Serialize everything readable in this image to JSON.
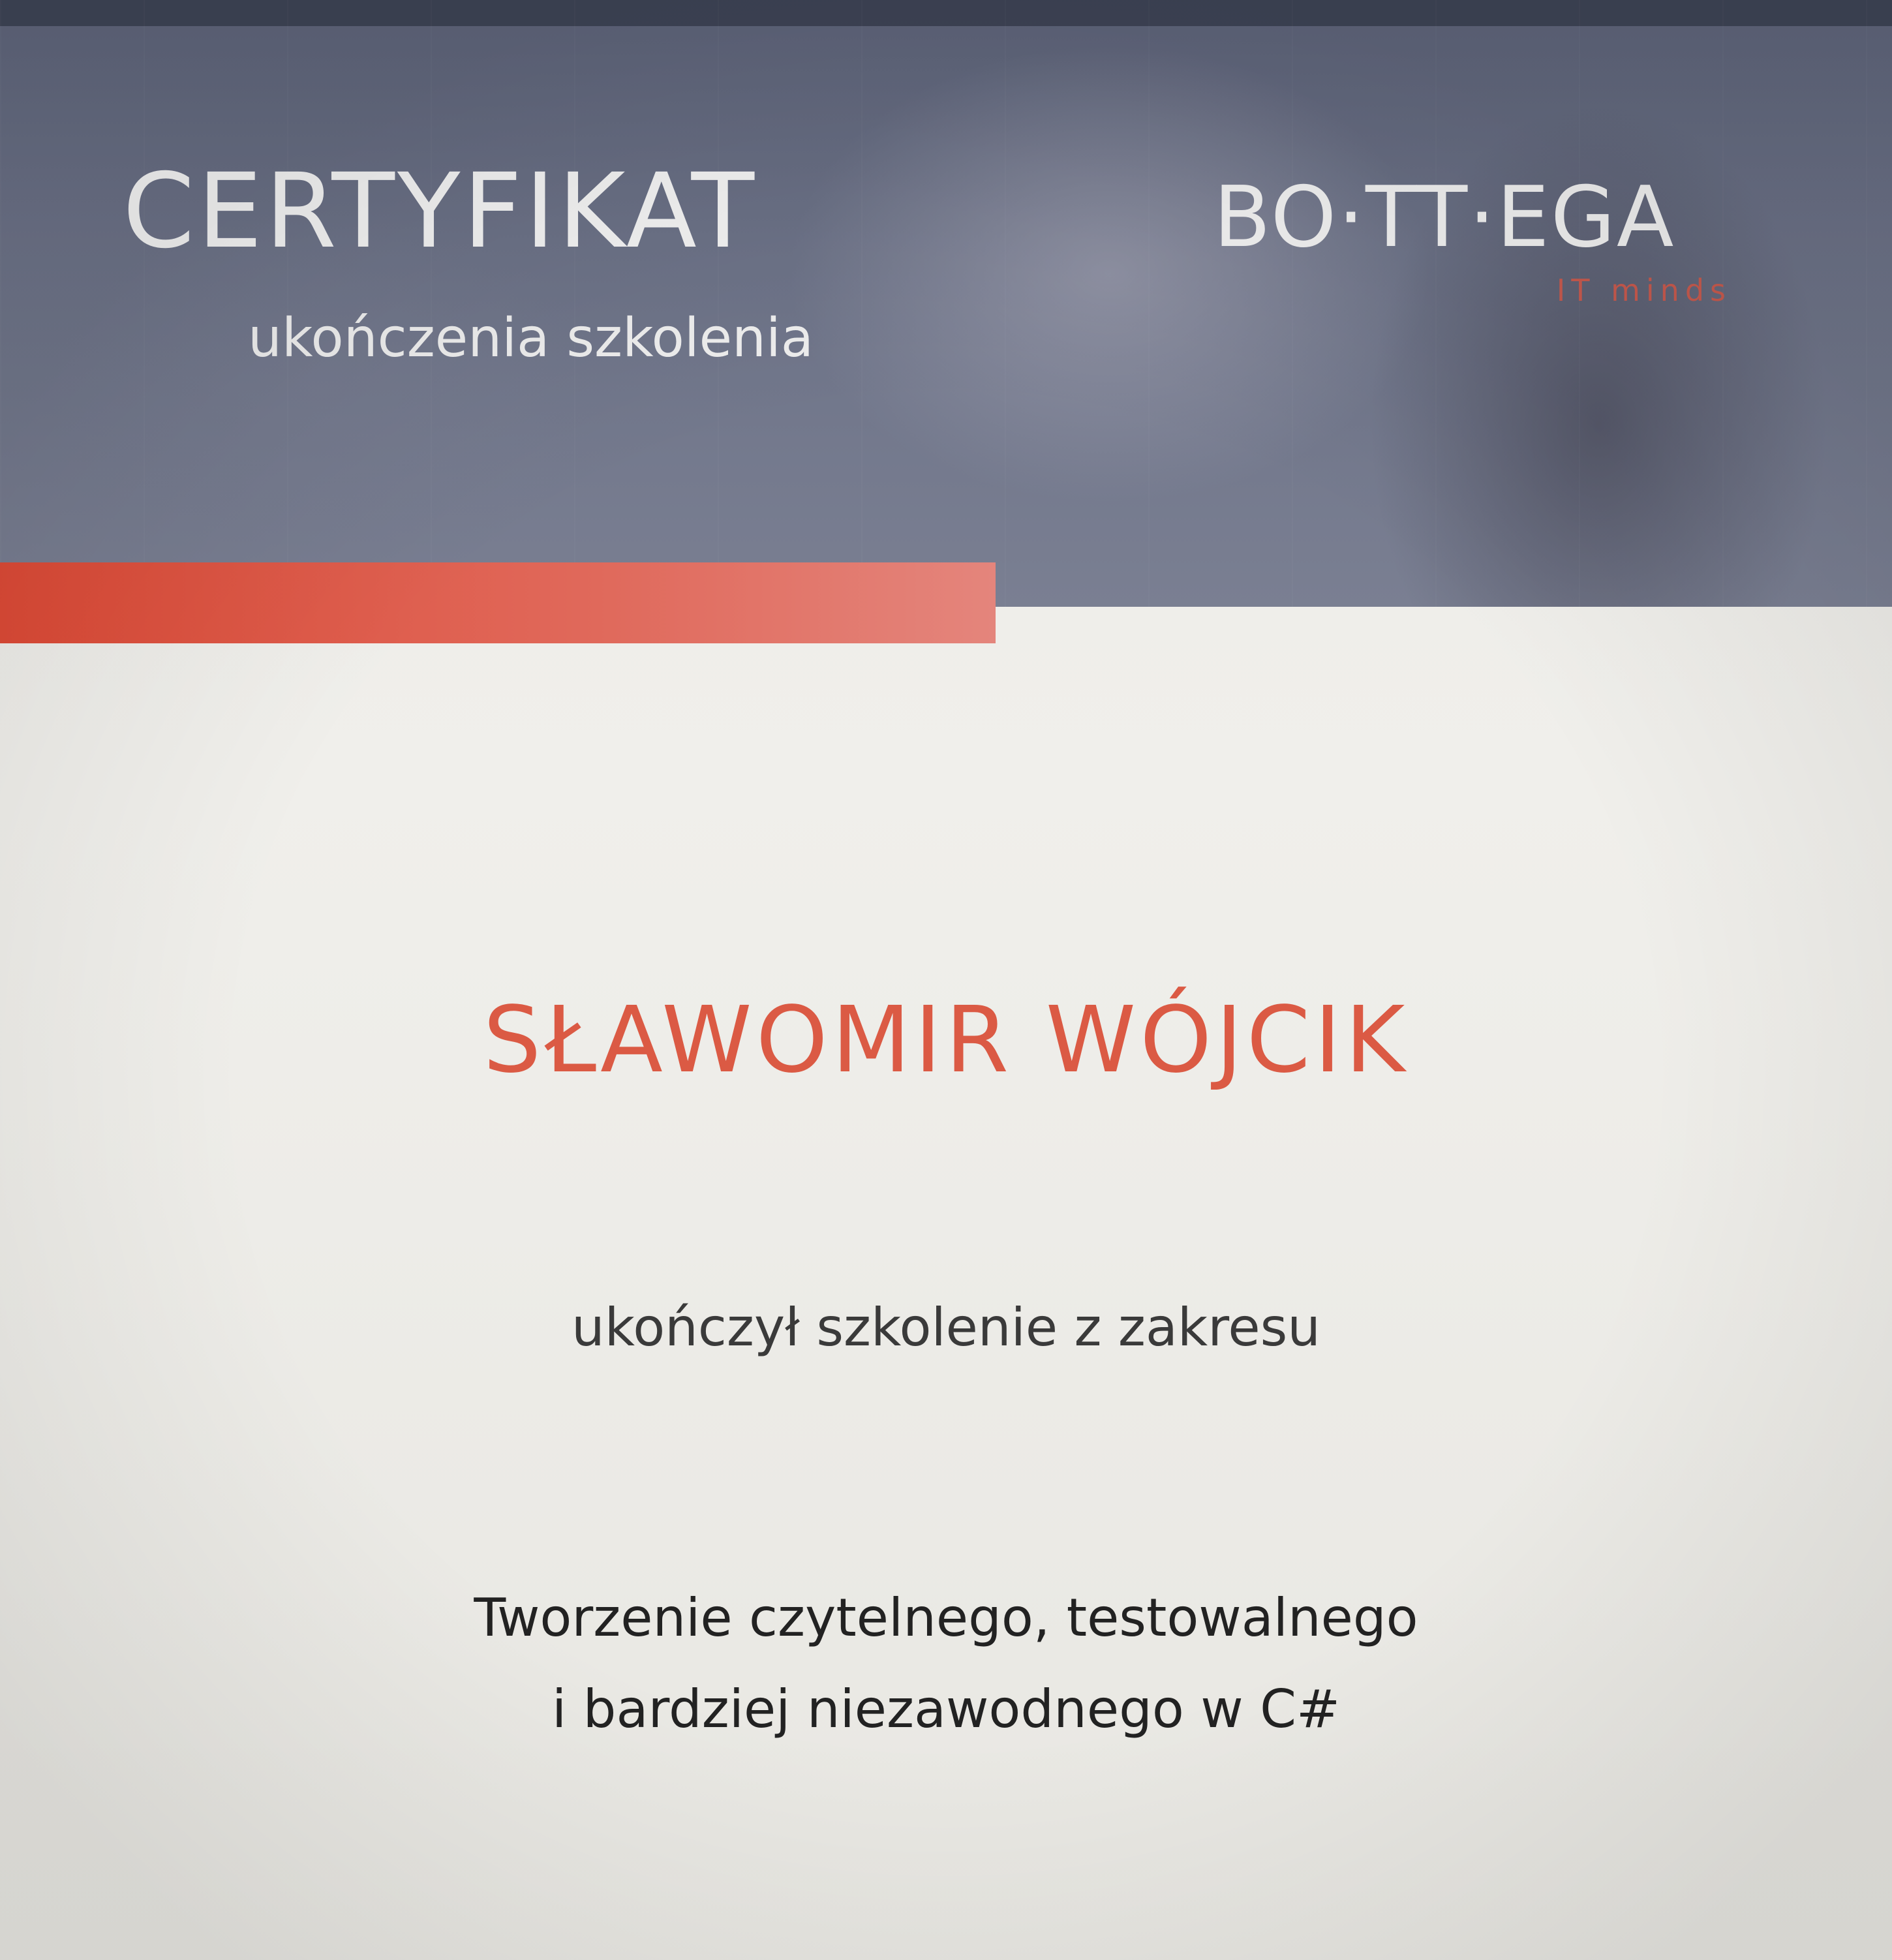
{
  "header": {
    "title": "CERTYFIKAT",
    "subtitle": "ukończenia szkolenia",
    "logo": {
      "name": "BO·TT·EGA",
      "tagline": "IT minds"
    }
  },
  "body": {
    "recipient": "SŁAWOMIR WÓJCIK",
    "completion_text": "ukończył szkolenie z zakresu",
    "course_lines": [
      "Tworzenie czytelnego, testowalnego",
      "i bardziej niezawodnego w C#"
    ]
  },
  "colors": {
    "accent": "#dd4a36",
    "header_band": "#6c7287",
    "background": "#ecebe7",
    "text": "#222222"
  }
}
